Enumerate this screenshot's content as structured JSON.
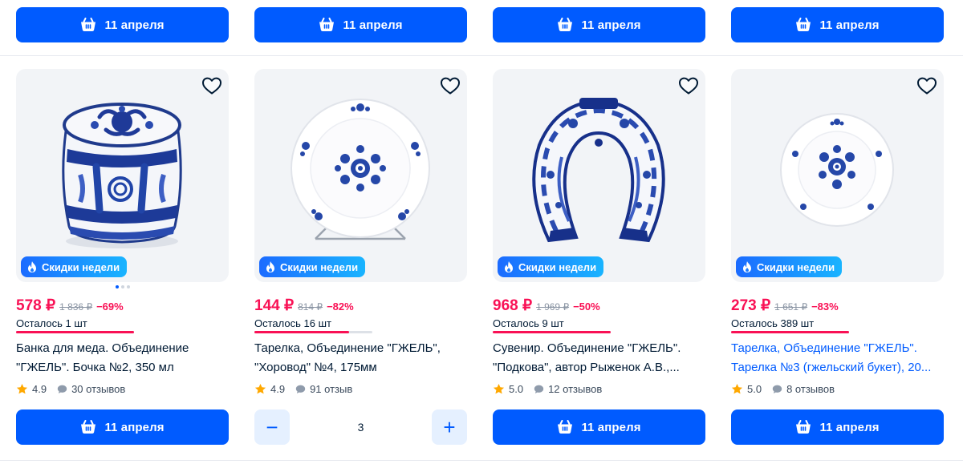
{
  "colors": {
    "accent": "#005bff",
    "sale": "#f91155",
    "badge_from": "#1b6bff",
    "badge_to": "#19b4ff"
  },
  "top_buttons": [
    {
      "label": "11 апреля",
      "icon": "basket-icon"
    },
    {
      "label": "11 апреля",
      "icon": "basket-icon"
    },
    {
      "label": "11 апреля",
      "icon": "basket-icon"
    },
    {
      "label": "11 апреля",
      "icon": "basket-icon"
    }
  ],
  "products": [
    {
      "badge": "Скидки недели",
      "price": "578 ₽",
      "old_price": "1 836 ₽",
      "discount": "−69%",
      "stock": "Осталось 1 шт",
      "stock_fraction": 1.0,
      "title_lines": [
        "Банка для меда. Объединение",
        "\"ГЖЕЛЬ\". Бочка №2, 350 мл"
      ],
      "rating": "4.9",
      "reviews": "30 отзывов",
      "action": "11 апреля",
      "image_dots": 3
    },
    {
      "badge": "Скидки недели",
      "price": "144 ₽",
      "old_price": "814 ₽",
      "discount": "−82%",
      "stock": "Осталось 16 шт",
      "stock_fraction": 0.8,
      "title_lines": [
        "Тарелка, Объединение \"ГЖЕЛЬ\",",
        "\"Хоровод\" №4, 175мм"
      ],
      "rating": "4.9",
      "reviews": "91 отзыв",
      "quantity": "3",
      "minus": "−",
      "plus": "+"
    },
    {
      "badge": "Скидки недели",
      "price": "968 ₽",
      "old_price": "1 969 ₽",
      "discount": "−50%",
      "stock": "Осталось 9 шт",
      "stock_fraction": 1.0,
      "title_lines": [
        "Сувенир. Объединение \"ГЖЕЛЬ\".",
        "\"Подкова\", автор Рыженок А.В.,..."
      ],
      "rating": "5.0",
      "reviews": "12 отзывов",
      "action": "11 апреля"
    },
    {
      "badge": "Скидки недели",
      "price": "273 ₽",
      "old_price": "1 651 ₽",
      "discount": "−83%",
      "stock": "Осталось 389 шт",
      "stock_fraction": 1.0,
      "title_lines": [
        "Тарелка, Объединение \"ГЖЕЛЬ\".",
        "Тарелка №3 (гжельский букет), 20..."
      ],
      "rating": "5.0",
      "reviews": "8 отзывов",
      "action": "11 апреля"
    }
  ]
}
